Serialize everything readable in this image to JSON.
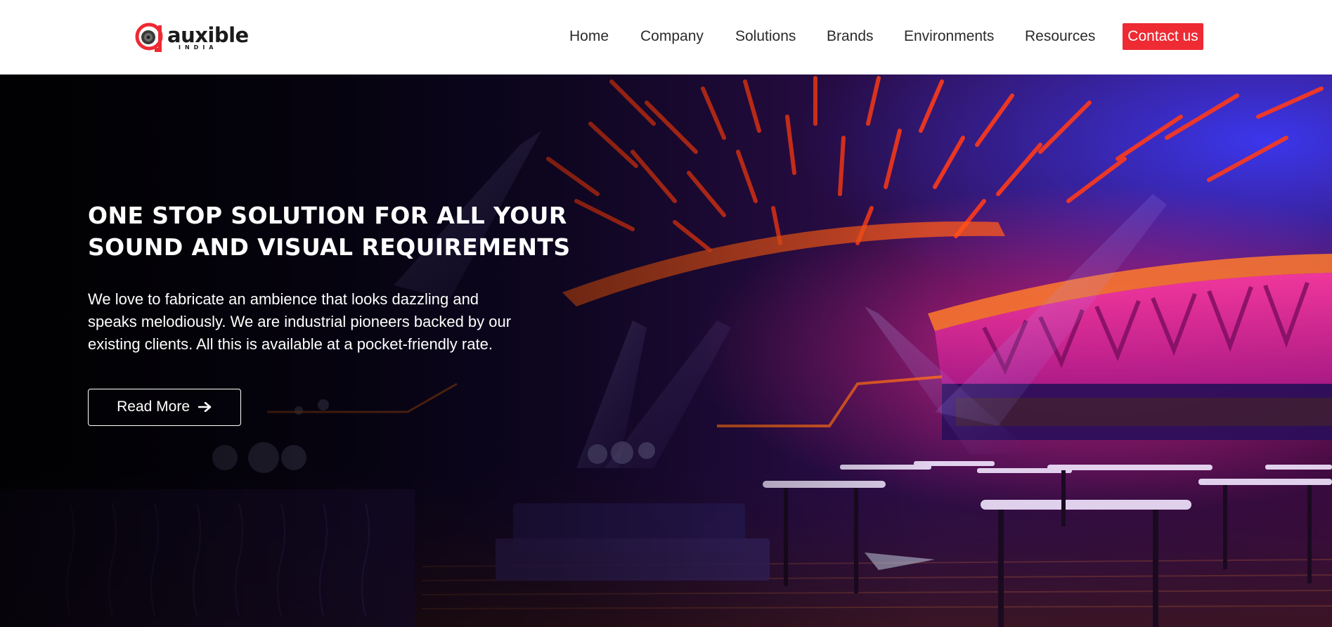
{
  "brand": {
    "name": "auxible",
    "subtitle": "INDIA",
    "accent_color": "#ee2a33"
  },
  "nav": {
    "items": [
      {
        "label": "Home"
      },
      {
        "label": "Company"
      },
      {
        "label": "Solutions"
      },
      {
        "label": "Brands"
      },
      {
        "label": "Environments"
      },
      {
        "label": "Resources"
      }
    ],
    "contact_label": "Contact us"
  },
  "hero": {
    "title_lines": [
      "ONE STOP SOLUTION FOR ALL YOUR",
      "SOUND AND VISUAL REQUIREMENTS"
    ],
    "text_lines": [
      "We love to fabricate an ambience that looks dazzling and",
      "speaks melodiously. We are industrial pioneers backed by our",
      "existing clients. All this is available at a pocket-friendly rate."
    ],
    "button_label": "Read More",
    "button_icon": "arrow-right-icon"
  }
}
